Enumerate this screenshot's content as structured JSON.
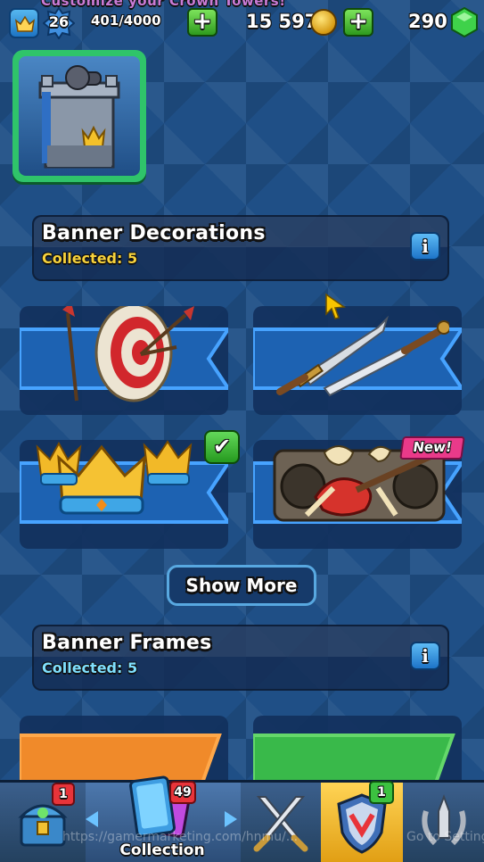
{
  "top_bar": {
    "hint": "Customize your Crown Towers!",
    "level": "26",
    "xp": "401/4000",
    "gold": "15 597",
    "gems": "290"
  },
  "sections": {
    "decorations": {
      "title": "Banner Decorations",
      "collected": "Collected: 5"
    },
    "frames": {
      "title": "Banner Frames",
      "collected": "Collected: 5"
    }
  },
  "tiles": {
    "new_badge": "New!"
  },
  "show_more": "Show More",
  "bottom_nav": {
    "shop_badge": "1",
    "collection_badge": "49",
    "collection_label": "Collection",
    "clan_badge": "1"
  },
  "overlay": {
    "watermark": "https://gamermarketing.com/hnmu/...",
    "go_to_settings": "Go to Setting"
  },
  "colors": {
    "background": "#1f4f86",
    "collected_decorations": "#f7d23c",
    "collected_frames": "#7fe0ff",
    "tower_frame": "#2fc46a",
    "active_nav": "#ffd455"
  }
}
